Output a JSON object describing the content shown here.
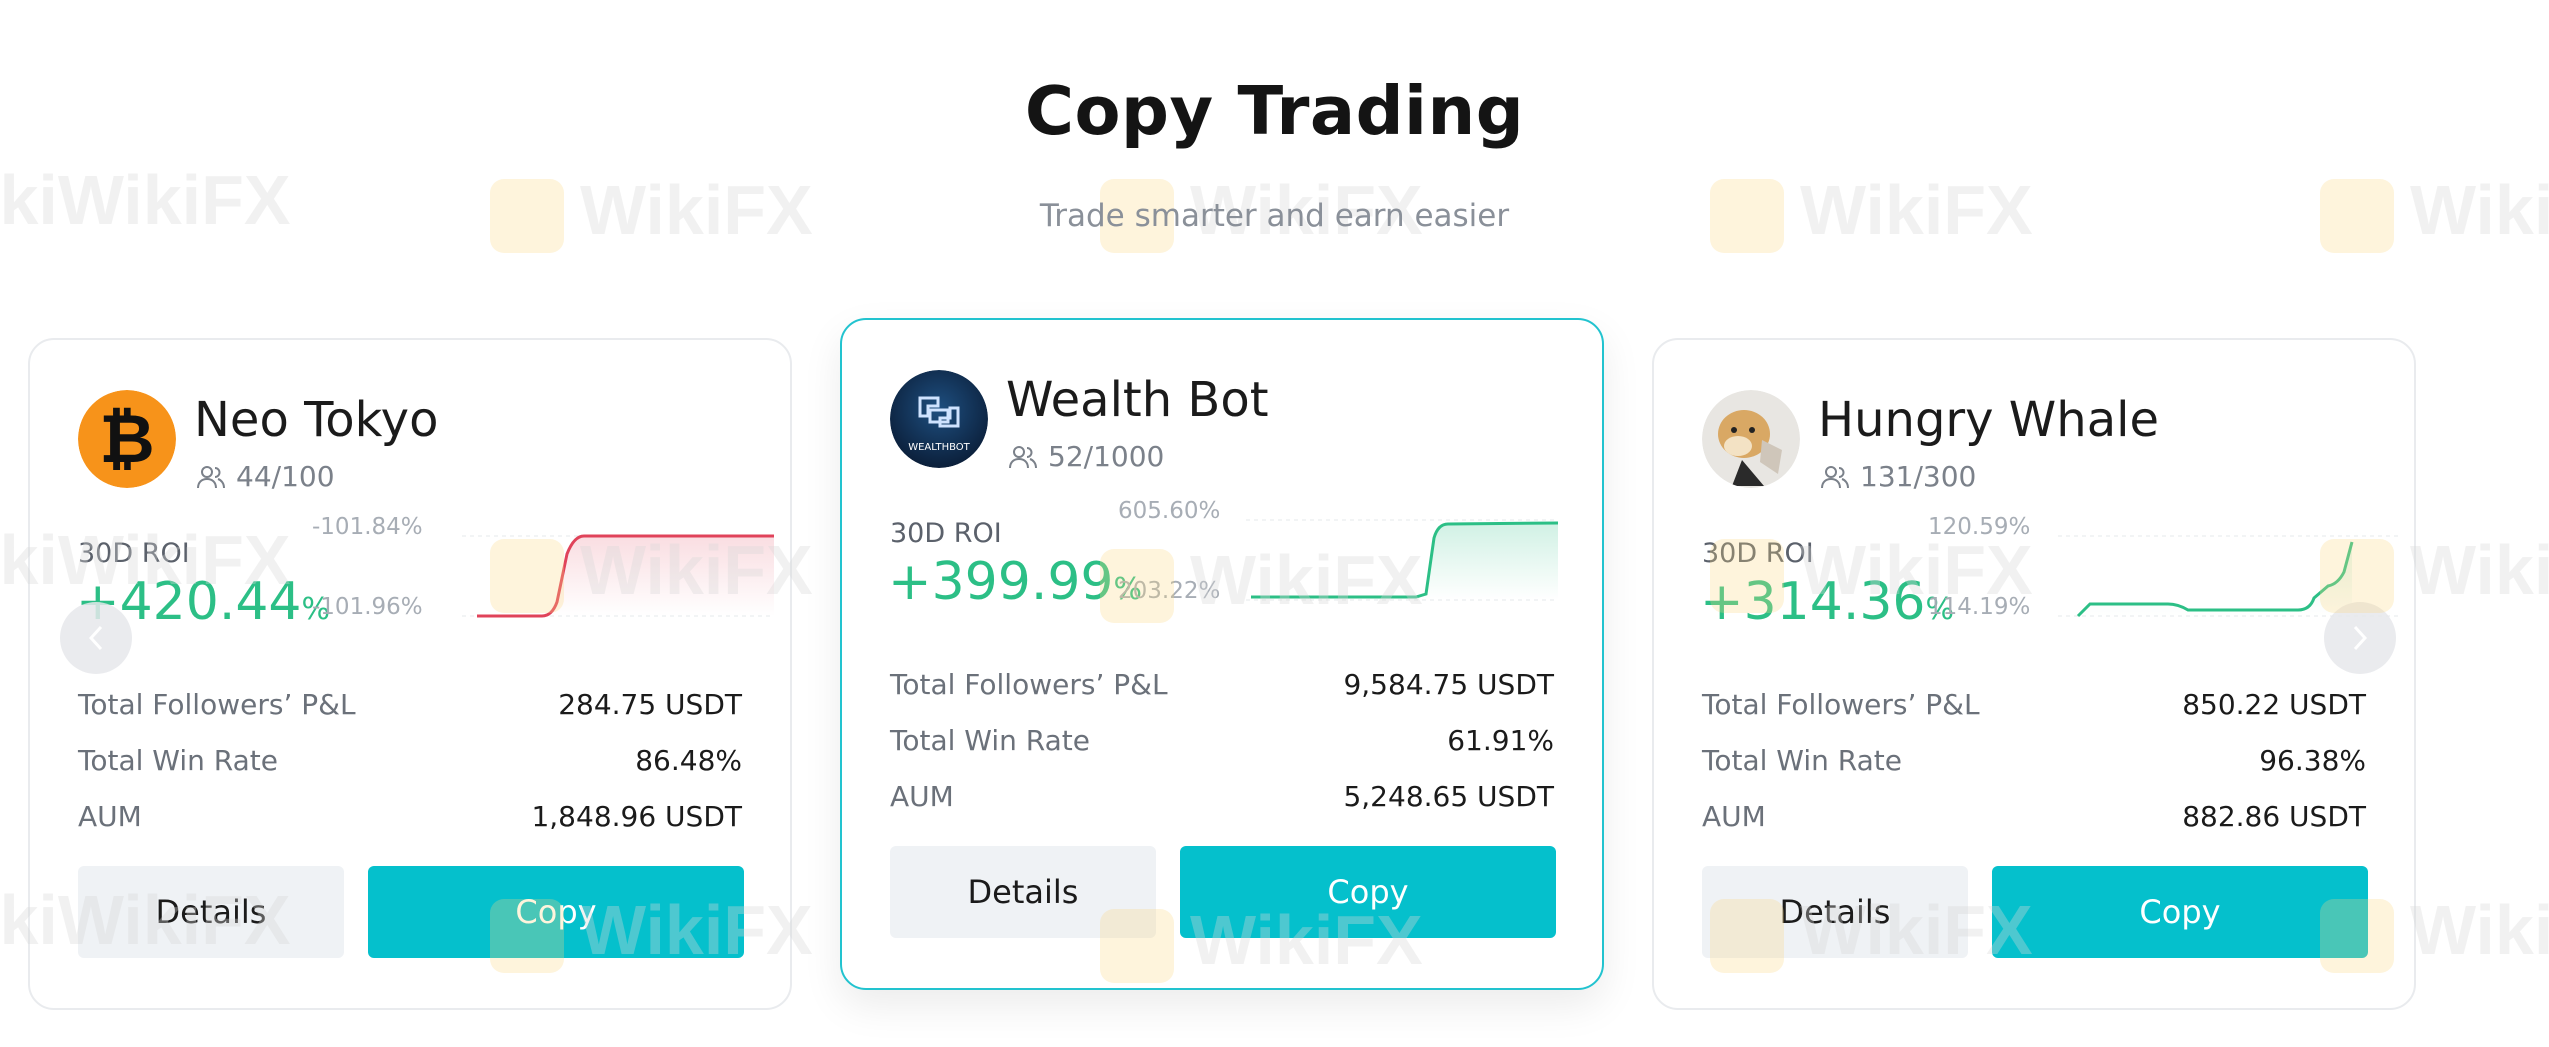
{
  "page": {
    "title": "Copy Trading",
    "subtitle": "Trade smarter and earn easier"
  },
  "watermark": "WikiFX",
  "labels": {
    "roi": "30D ROI",
    "followers_pnl": "Total Followers’ P&L",
    "win_rate": "Total Win Rate",
    "aum": "AUM",
    "details_button": "Details",
    "copy_button": "Copy",
    "percent_suffix": "%"
  },
  "colors": {
    "accent": "#05c0cc",
    "positive": "#2cbf86",
    "negative_line": "#e0435a"
  },
  "traders": [
    {
      "name": "Neo Tokyo",
      "followers": "44/100",
      "avatar_icon": "bitcoin-icon",
      "roi": "+420.44",
      "chart_high": "-101.84%",
      "chart_low": "-101.96%",
      "followers_pnl": "284.75 USDT",
      "win_rate": "86.48%",
      "aum": "1,848.96 USDT",
      "trend": "down-red"
    },
    {
      "name": "Wealth Bot",
      "followers": "52/1000",
      "avatar_icon": "wealthbot-logo-icon",
      "avatar_text": "WEALTHBOT",
      "roi": "+399.99",
      "chart_high": "605.60%",
      "chart_low": "203.22%",
      "followers_pnl": "9,584.75 USDT",
      "win_rate": "61.91%",
      "aum": "5,248.65 USDT",
      "trend": "up-green"
    },
    {
      "name": "Hungry Whale",
      "followers": "131/300",
      "avatar_icon": "doge-avatar-icon",
      "roi": "+314.36",
      "chart_high": "120.59%",
      "chart_low": "114.19%",
      "followers_pnl": "850.22 USDT",
      "win_rate": "96.38%",
      "aum": "882.86 USDT",
      "trend": "up-green"
    }
  ]
}
